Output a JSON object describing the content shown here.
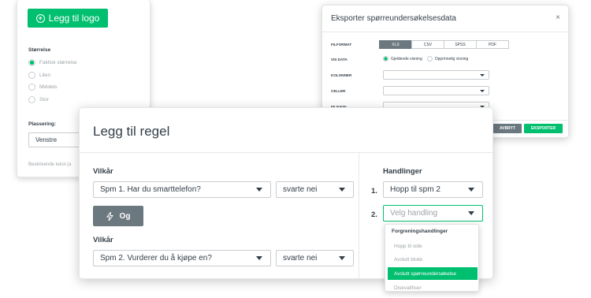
{
  "logo_panel": {
    "add_logo_label": "Legg til logo",
    "size_label": "Størrelse",
    "size_options": [
      "Faktisk størrelse",
      "Liten",
      "Middels",
      "Stor"
    ],
    "selected_size_index": 0,
    "placement_label": "Plassering:",
    "placement_value": "Venstre",
    "alt_text_label": "Beskrivende tekst (a"
  },
  "export_dialog": {
    "title": "Eksporter spørreundersøkelsesdata",
    "close_glyph": "×",
    "file_format_label": "FILFORMAT",
    "formats": [
      "XLS",
      "CSV",
      "SPSS",
      "PDF"
    ],
    "active_format": "XLS",
    "view_label": "VIS DATA",
    "view_options": [
      "Gjeldende visning",
      "Opprinnelig visning"
    ],
    "columns_label": "KOLONNER",
    "cells_label": "CELLER",
    "filename_label": "FILNAVN",
    "cancel_label": "AVBRYT",
    "export_label": "EKSPORTER"
  },
  "rule_modal": {
    "title": "Legg til regel",
    "condition_label_1": "Vilkår",
    "question_1": "Spm 1. Har du smarttelefon?",
    "answer_1": "svarte nei",
    "and_label": "Og",
    "condition_label_2": "Vilkår",
    "question_2": "Spm 2. Vurderer du å kjøpe en?",
    "answer_2": "svarte nei",
    "actions_label": "Handlinger",
    "action_1_number": "1.",
    "action_1_value": "Hopp til spm 2",
    "action_2_number": "2.",
    "action_2_placeholder": "Velg handling",
    "menu": {
      "group_label": "Forgreningshandlinger",
      "items": [
        "Hopp til side",
        "Avslutt blokk",
        "Avslutt spørreundersøkelse",
        "Diskvalifiser"
      ],
      "selected_index": 2
    }
  },
  "colors": {
    "accent": "#00bf6f",
    "secondary_button": "#6b787f",
    "text": "#333e48",
    "muted_text": "#9da3a8",
    "border": "#c9cdd1"
  }
}
